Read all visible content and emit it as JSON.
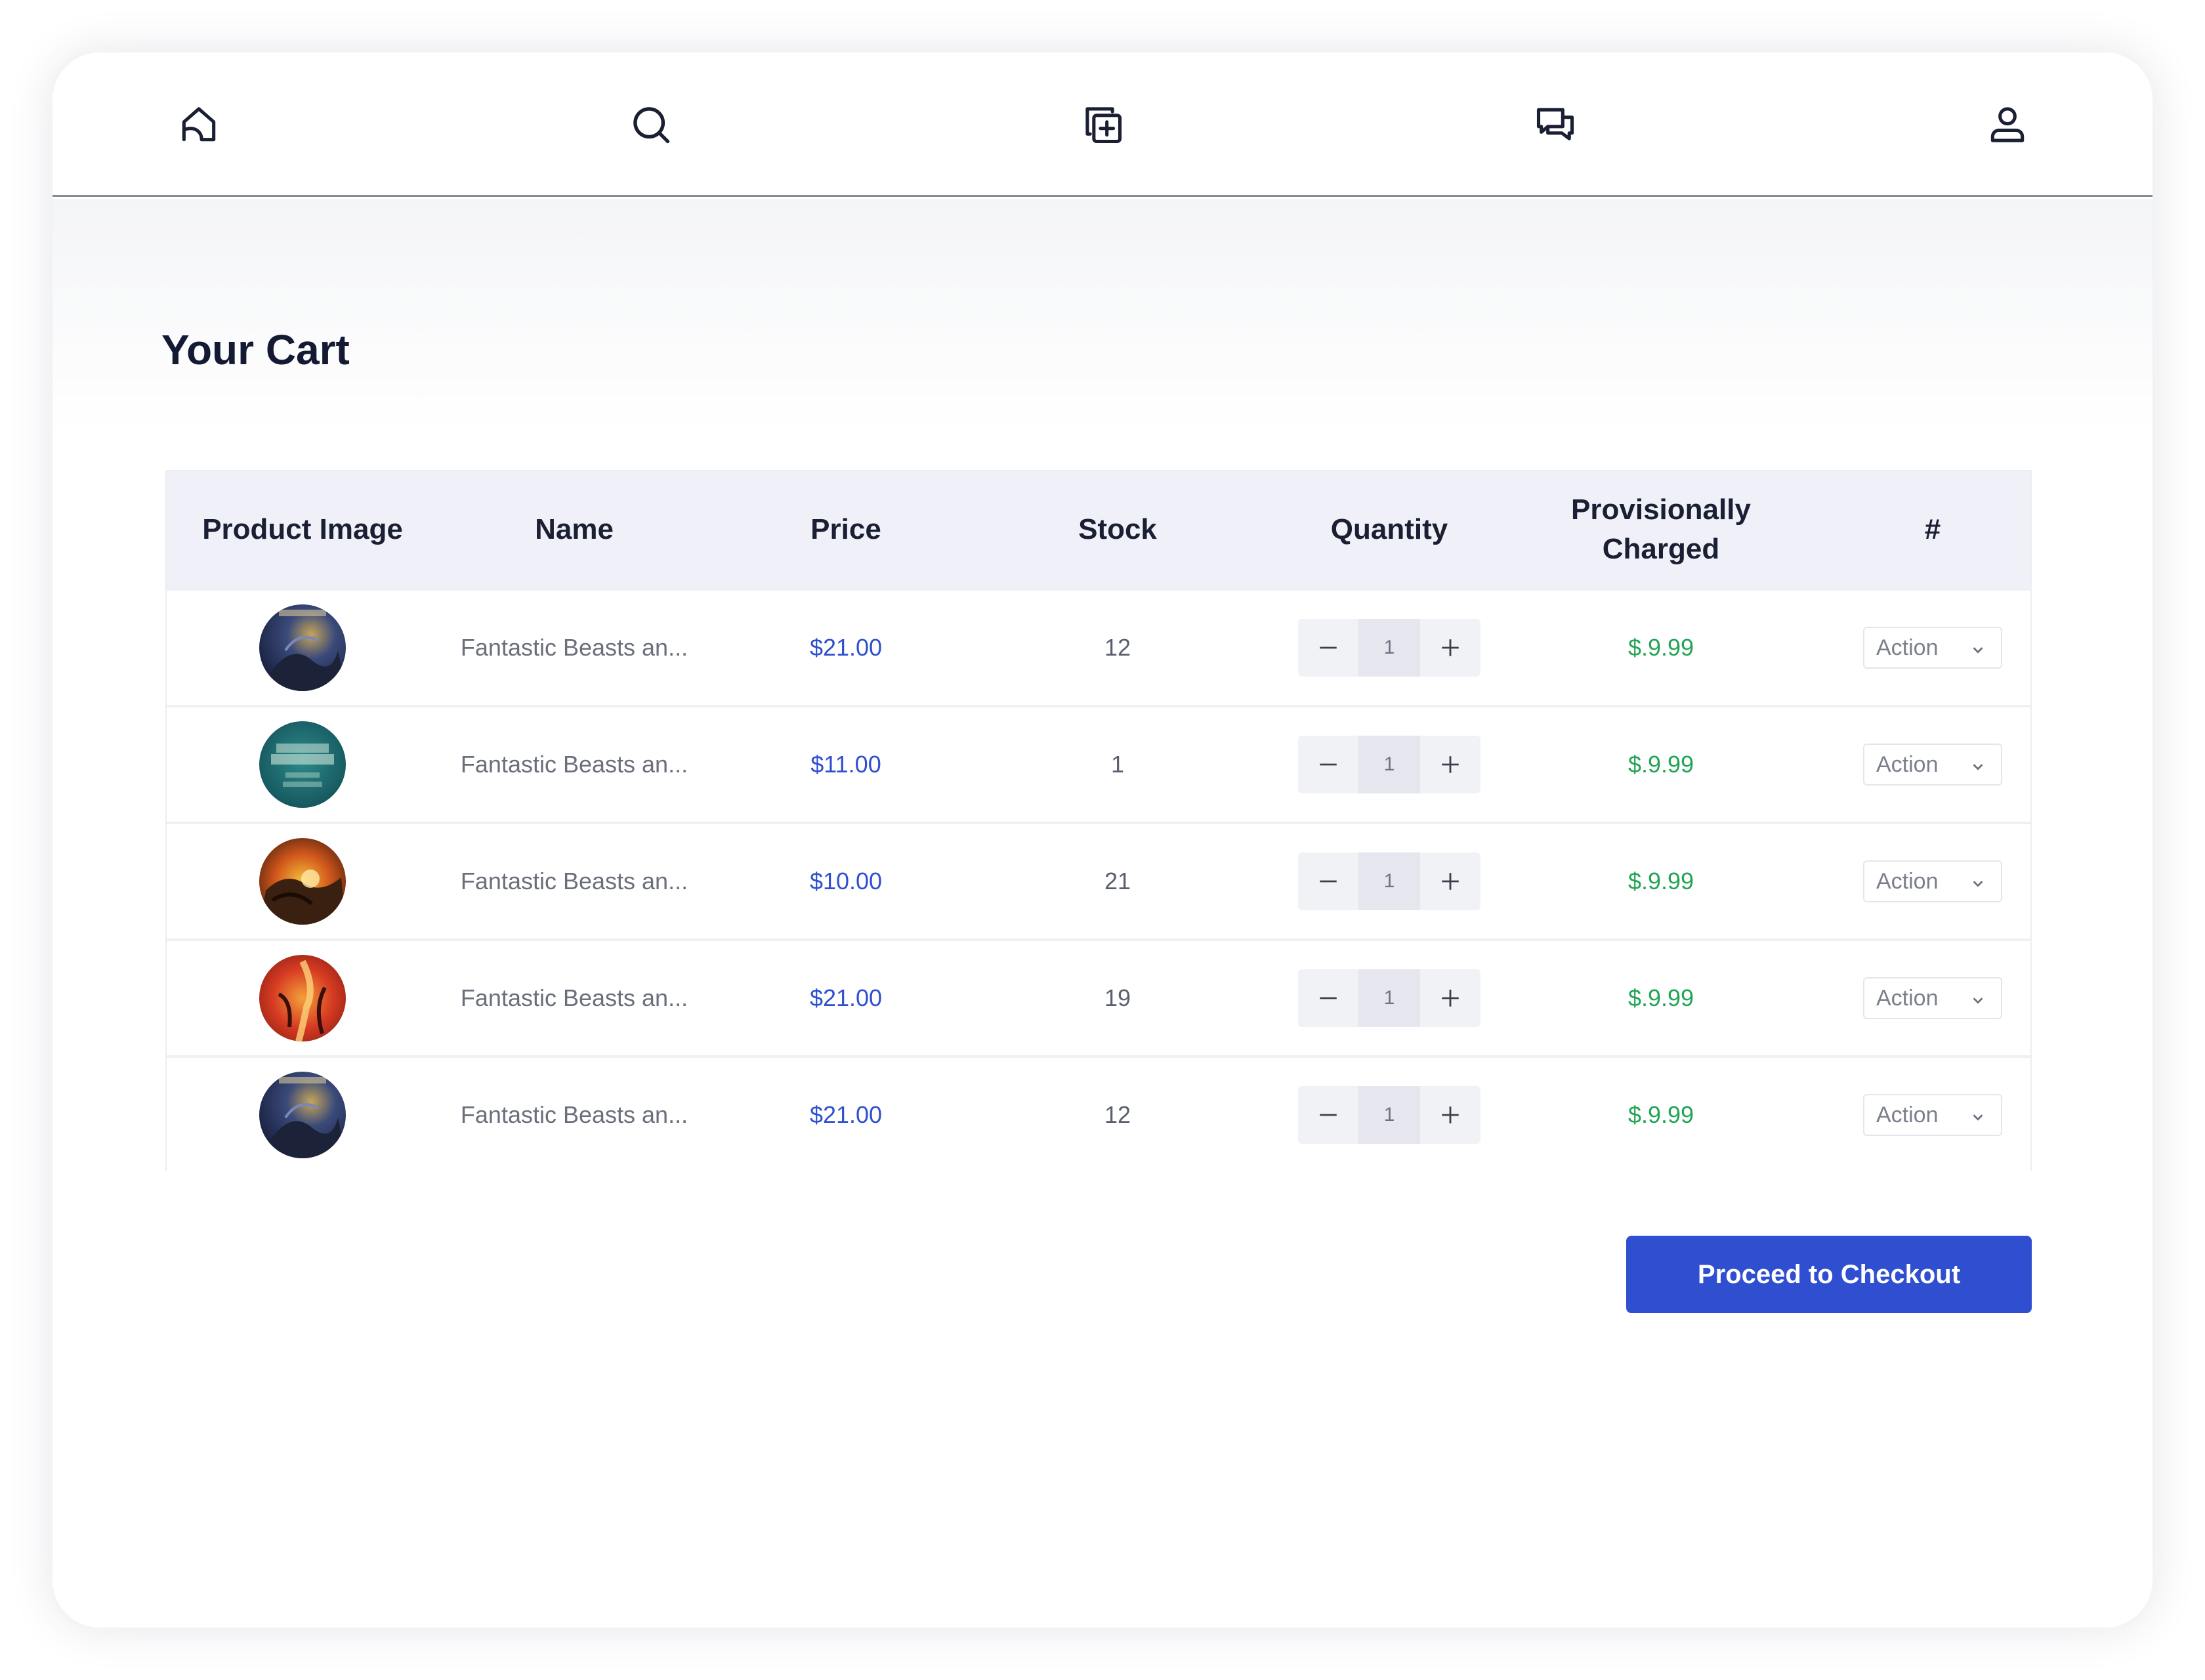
{
  "nav": {
    "items": [
      {
        "icon": "home-icon",
        "label": ""
      },
      {
        "icon": "search-icon",
        "label": ""
      },
      {
        "icon": "add-item-icon",
        "label": ""
      },
      {
        "icon": "chat-icon",
        "label": ""
      },
      {
        "icon": "user-icon",
        "label": ""
      }
    ]
  },
  "page": {
    "title": "Your Cart"
  },
  "table": {
    "headers": {
      "image": "Product Image",
      "name": "Name",
      "price": "Price",
      "stock": "Stock",
      "quantity": "Quantity",
      "charged": "Provisionally\nCharged",
      "hash": "#"
    },
    "rows": [
      {
        "name": "Fantastic Beasts an...",
        "price": "$21.00",
        "stock": "12",
        "quantity": "1",
        "charged": "$.9.99",
        "action": "Action"
      },
      {
        "name": "Fantastic Beasts an...",
        "price": "$11.00",
        "stock": "1",
        "quantity": "1",
        "charged": "$.9.99",
        "action": "Action"
      },
      {
        "name": "Fantastic Beasts an...",
        "price": "$10.00",
        "stock": "21",
        "quantity": "1",
        "charged": "$.9.99",
        "action": "Action"
      },
      {
        "name": "Fantastic Beasts an...",
        "price": "$21.00",
        "stock": "19",
        "quantity": "1",
        "charged": "$.9.99",
        "action": "Action"
      },
      {
        "name": "Fantastic Beasts an...",
        "price": "$21.00",
        "stock": "12",
        "quantity": "1",
        "charged": "$.9.99",
        "action": "Action"
      }
    ]
  },
  "checkout": {
    "label": "Proceed to Checkout"
  },
  "colors": {
    "accent": "#2f4fd0",
    "price": "#2f4fd0",
    "charged": "#21a453",
    "header_bg": "#eff0f8",
    "title": "#141a33"
  }
}
